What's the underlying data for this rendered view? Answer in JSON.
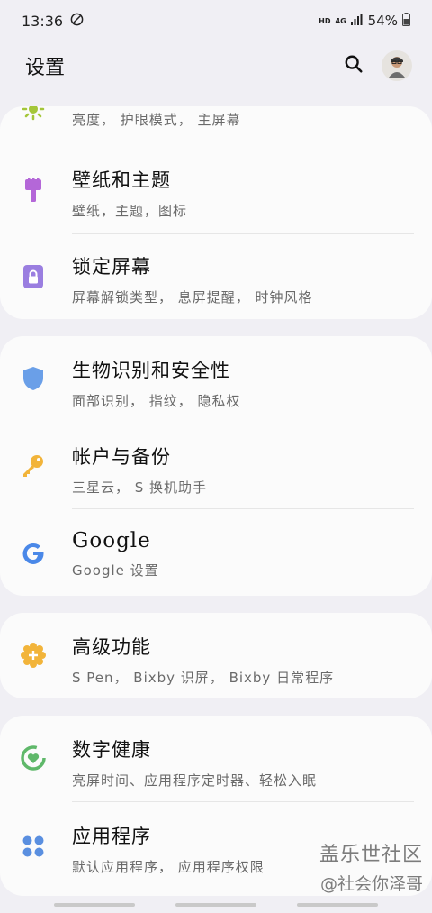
{
  "status_bar": {
    "time": "13:36",
    "hd": "HD",
    "network": "4G",
    "battery": "54%"
  },
  "header": {
    "title": "设置",
    "search_icon": "search-icon",
    "avatar_icon": "avatar"
  },
  "cards": [
    {
      "items": [
        {
          "title": "",
          "subtitle": "亮度， 护眼模式， 主屏幕",
          "icon": "brightness-icon",
          "color": "#a4c639"
        },
        {
          "title": "壁纸和主题",
          "subtitle": "壁纸，主题，图标",
          "icon": "paintbrush-icon",
          "color": "#b467d8"
        },
        {
          "title": "锁定屏幕",
          "subtitle": "屏幕解锁类型， 息屏提醒， 时钟风格",
          "icon": "lock-icon",
          "color": "#9a7ee0"
        }
      ]
    },
    {
      "items": [
        {
          "title": "生物识别和安全性",
          "subtitle": "面部识别， 指纹， 隐私权",
          "icon": "shield-icon",
          "color": "#6a9fe8"
        },
        {
          "title": "帐户与备份",
          "subtitle": "三星云， S 换机助手",
          "icon": "key-icon",
          "color": "#f2b43a"
        },
        {
          "title": "Google",
          "subtitle": "Google 设置",
          "icon": "google-icon",
          "color": "#4a88e8"
        }
      ]
    },
    {
      "items": [
        {
          "title": "高级功能",
          "subtitle": "S Pen， Bixby 识屏， Bixby 日常程序",
          "icon": "gear-plus-icon",
          "color": "#f2b43a"
        }
      ]
    },
    {
      "items": [
        {
          "title": "数字健康",
          "subtitle": "亮屏时间、应用程序定时器、轻松入眠",
          "icon": "wellbeing-icon",
          "color": "#5fb86a"
        },
        {
          "title": "应用程序",
          "subtitle": "默认应用程序， 应用程序权限",
          "icon": "apps-icon",
          "color": "#5a8fe0"
        }
      ]
    }
  ],
  "watermark": {
    "line1": "盖乐世社区",
    "line2": "@社会你泽哥"
  }
}
